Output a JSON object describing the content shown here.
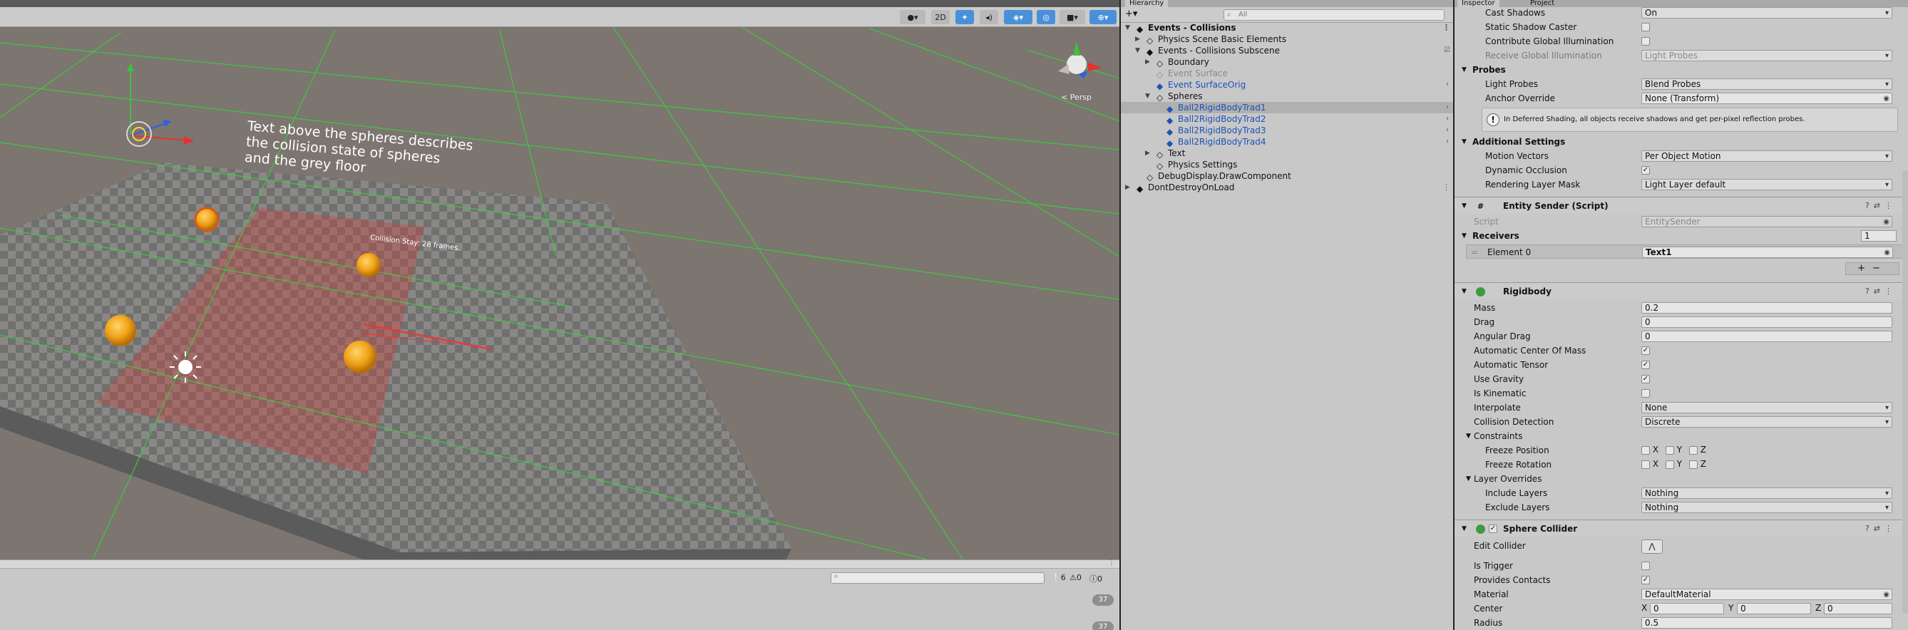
{
  "scene": {
    "toolbar": {
      "mode_2d": "2D"
    },
    "annotation": [
      "Text above the spheres describes",
      "the collision state of spheres",
      "and the grey floor"
    ],
    "collision_label": "Collision Stay: 28 frames.",
    "persp_label": "< Persp"
  },
  "console": {
    "info_count": "6",
    "warn_count": "0",
    "error_count": "0",
    "row_counts": [
      "37",
      "37"
    ]
  },
  "hierarchy": {
    "tab": "Hierarchy",
    "search_placeholder": "All",
    "rows": [
      {
        "label": "Events - Collisions"
      },
      {
        "label": "Physics Scene Basic Elements"
      },
      {
        "label": "Events - Collisions Subscene"
      },
      {
        "label": "Boundary"
      },
      {
        "label": "Event Surface"
      },
      {
        "label": "Event SurfaceOrig"
      },
      {
        "label": "Spheres"
      },
      {
        "label": "Ball2RigidBodyTrad1"
      },
      {
        "label": "Ball2RigidBodyTrad2"
      },
      {
        "label": "Ball2RigidBodyTrad3"
      },
      {
        "label": "Ball2RigidBodyTrad4"
      },
      {
        "label": "Text"
      },
      {
        "label": "Physics Settings"
      },
      {
        "label": "DebugDisplay.DrawComponent"
      },
      {
        "label": "DontDestroyOnLoad"
      }
    ]
  },
  "inspector": {
    "tabs": {
      "inspector": "Inspector",
      "project": "Project"
    },
    "renderer": {
      "cast_shadows_label": "Cast Shadows",
      "cast_shadows_value": "On",
      "static_shadow_caster_label": "Static Shadow Caster",
      "contribute_gi_label": "Contribute Global Illumination",
      "receive_gi_label": "Receive Global Illumination",
      "receive_gi_value": "Light Probes",
      "probes_header": "Probes",
      "light_probes_label": "Light Probes",
      "light_probes_value": "Blend Probes",
      "anchor_override_label": "Anchor Override",
      "anchor_override_value": "None (Transform)",
      "help_text": "In Deferred Shading, all objects receive shadows and get per-pixel reflection probes.",
      "additional_header": "Additional Settings",
      "motion_vectors_label": "Motion Vectors",
      "motion_vectors_value": "Per Object Motion",
      "dynamic_occlusion_label": "Dynamic Occlusion",
      "rendering_layer_label": "Rendering Layer Mask",
      "rendering_layer_value": "Light Layer default"
    },
    "entity_sender": {
      "title": "Entity Sender (Script)",
      "script_label": "Script",
      "script_value": "EntitySender",
      "receivers_label": "Receivers",
      "receivers_count": "1",
      "element0_label": "Element 0",
      "element0_value": "Text1"
    },
    "rigidbody": {
      "title": "Rigidbody",
      "mass_label": "Mass",
      "mass_value": "0.2",
      "drag_label": "Drag",
      "drag_value": "0",
      "angular_drag_label": "Angular Drag",
      "angular_drag_value": "0",
      "auto_com_label": "Automatic Center Of Mass",
      "auto_tensor_label": "Automatic Tensor",
      "use_gravity_label": "Use Gravity",
      "is_kinematic_label": "Is Kinematic",
      "interpolate_label": "Interpolate",
      "interpolate_value": "None",
      "collision_detection_label": "Collision Detection",
      "collision_detection_value": "Discrete",
      "constraints_label": "Constraints",
      "freeze_position_label": "Freeze Position",
      "freeze_rotation_label": "Freeze Rotation",
      "axis_x": "X",
      "axis_y": "Y",
      "axis_z": "Z",
      "layer_overrides_label": "Layer Overrides",
      "include_layers_label": "Include Layers",
      "include_layers_value": "Nothing",
      "exclude_layers_label": "Exclude Layers",
      "exclude_layers_value": "Nothing"
    },
    "sphere_collider": {
      "title": "Sphere Collider",
      "edit_collider_label": "Edit Collider",
      "is_trigger_label": "Is Trigger",
      "provides_contacts_label": "Provides Contacts",
      "material_label": "Material",
      "material_value": "DefaultMaterial",
      "center_label": "Center",
      "center_x_label": "X",
      "center_x": "0",
      "center_y_label": "Y",
      "center_y": "0",
      "center_z_label": "Z",
      "center_z": "0",
      "radius_label": "Radius",
      "radius_value": "0.5"
    }
  }
}
